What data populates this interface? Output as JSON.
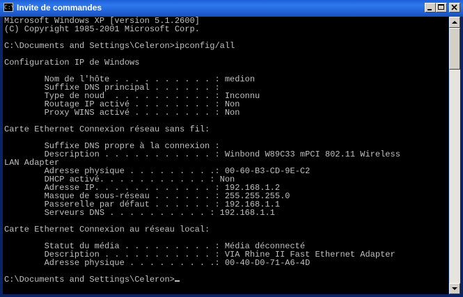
{
  "window": {
    "title": "Invite de commandes",
    "icon_label": "C:\\"
  },
  "console": {
    "lines": [
      "Microsoft Windows XP [version 5.1.2600]",
      "(C) Copyright 1985-2001 Microsoft Corp.",
      "",
      "C:\\Documents and Settings\\Celeron>ipconfig/all",
      "",
      "Configuration IP de Windows",
      "",
      "        Nom de l'hôte . . . . . . . . . . : medion",
      "        Suffixe DNS principal . . . . . . :",
      "        Type de noud  . . . . . . . . . . : Inconnu",
      "        Routage IP activé . . . . . . . . : Non",
      "        Proxy WINS activé . . . . . . . . : Non",
      "",
      "Carte Ethernet Connexion réseau sans fil:",
      "",
      "        Suffixe DNS propre à la connexion : ",
      "        Description . . . . . . . . . . . : Winbond W89C33 mPCI 802.11 Wireless",
      "LAN Adapter",
      "        Adresse physique . . . . . . . . .: 00-60-B3-CD-9E-C2",
      "        DHCP activé. . . . . . . . . . . : Non",
      "        Adresse IP. . . . . . . . . . . . : 192.168.1.2",
      "        Masque de sous-réseau . . . . . . : 255.255.255.0",
      "        Passerelle par défaut . . . . . . : 192.168.1.1",
      "        Serveurs DNS . . . . . . . . . . : 192.168.1.1",
      "",
      "Carte Ethernet Connexion au réseau local:",
      "",
      "        Statut du média . . . . . . . . . : Média déconnecté",
      "        Description . . . . . . . . . . . : VIA Rhine II Fast Ethernet Adapter",
      "        Adresse physique . . . . . . . . .: 00-40-D0-71-A6-4D",
      "",
      "C:\\Documents and Settings\\Celeron>"
    ]
  },
  "icons": {
    "minimize": "minimize-icon",
    "maximize": "maximize-icon",
    "close": "close-icon",
    "scroll_up": "arrow-up-icon",
    "scroll_down": "arrow-down-icon"
  },
  "colors": {
    "titlebar": "#1f5fd3",
    "console_bg": "#000000",
    "console_text": "#c0c0c0"
  }
}
